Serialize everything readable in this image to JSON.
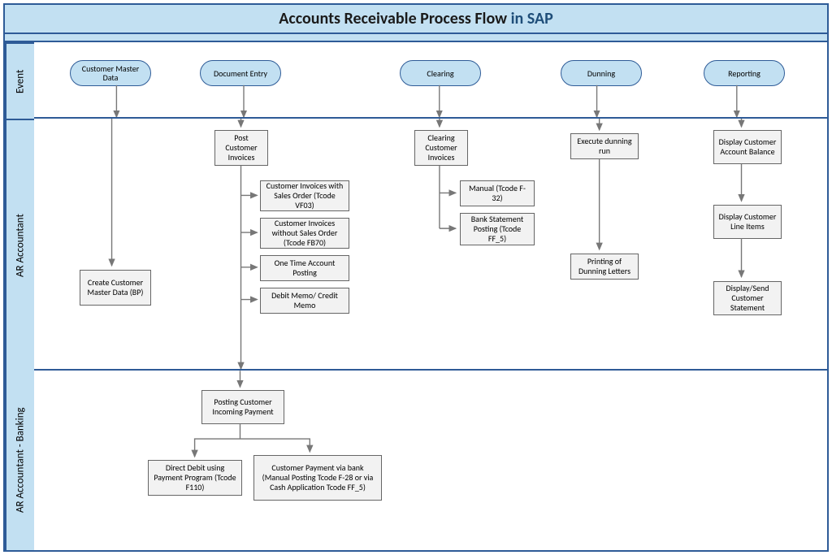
{
  "title_prefix": "Accounts Receivable Process Flow ",
  "title_suffix": "in SAP",
  "lanes": {
    "event": "Event",
    "ar": "AR Accountant",
    "bank": "AR Accountant - Banking"
  },
  "events": {
    "cust_master": "Customer Master Data",
    "doc_entry": "Document Entry",
    "clearing": "Clearing",
    "dunning": "Dunning",
    "reporting": "Reporting"
  },
  "ar": {
    "create_bp": "Create Customer Master Data (BP)",
    "post_inv": "Post Customer Invoices",
    "inv_so": "Customer Invoices with Sales Order (Tcode VF03)",
    "inv_no_so": "Customer Invoices without Sales Order (Tcode FB70)",
    "one_time": "One Time Account Posting",
    "memo": "Debit Memo/ Credit Memo",
    "clear_inv": "Clearing Customer Invoices",
    "clear_manual": "Manual (Tcode F-32)",
    "clear_bank": "Bank Statement Posting (Tcode FF_5)",
    "exec_dun": "Execute dunning run",
    "print_dun": "Printing of Dunning Letters",
    "disp_bal": "Display Customer Account Balance",
    "disp_items": "Display Customer Line Items",
    "disp_stmt": "Display/Send Customer Statement"
  },
  "bank": {
    "post_pay": "Posting Customer Incoming Payment",
    "dd": "Direct Debit using Payment Program (Tcode F110)",
    "cust_pay": "Customer Payment via bank (Manual Posting Tcode F-28 or via Cash Application Tcode FF_5)"
  }
}
